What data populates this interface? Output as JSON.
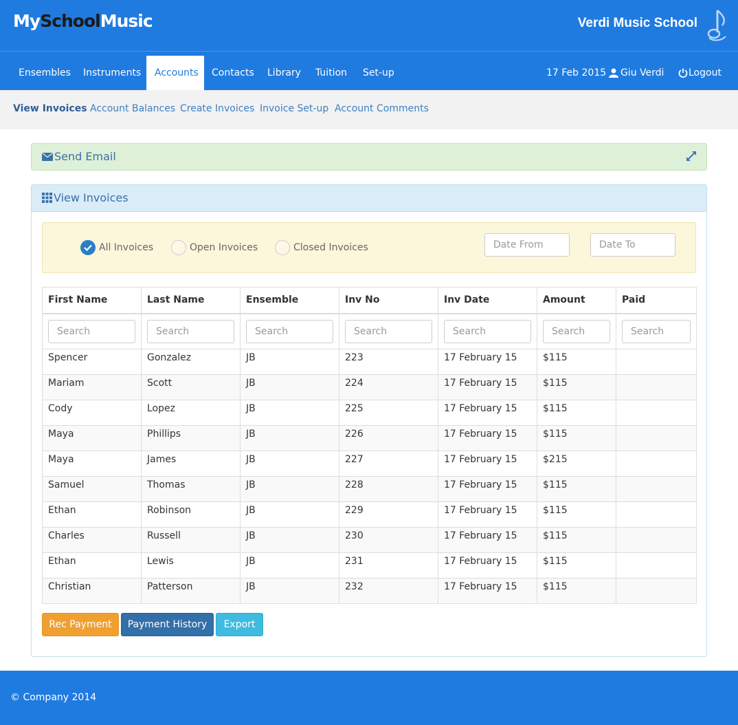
{
  "brand": {
    "logo_prefix": "My",
    "logo_mid": "School",
    "logo_suffix": "Music",
    "school_name": "Verdi Music School"
  },
  "nav": {
    "items": [
      "Ensembles",
      "Instruments",
      "Accounts",
      "Contacts",
      "Library",
      "Tuition",
      "Set-up"
    ],
    "active": "Accounts",
    "date": "17 Feb 2015",
    "user": "Giu Verdi",
    "logout": "Logout"
  },
  "subnav": {
    "items": [
      "View Invoices",
      "Account Balances",
      "Create Invoices",
      "Invoice Set-up",
      "Account Comments"
    ],
    "active": "View Invoices"
  },
  "email_panel": {
    "title": "Send Email"
  },
  "invoices_panel": {
    "title": "View Invoices",
    "filters": {
      "all": "All Invoices",
      "open": "Open Invoices",
      "closed": "Closed Invoices",
      "selected": "All Invoices"
    },
    "date_from_placeholder": "Date From",
    "date_to_placeholder": "Date To",
    "columns": [
      "First Name",
      "Last Name",
      "Ensemble",
      "Inv No",
      "Inv Date",
      "Amount",
      "Paid"
    ],
    "search_placeholder": "Search",
    "rows": [
      [
        "Spencer",
        "Gonzalez",
        "JB",
        "223",
        "17 February 15",
        "$115",
        ""
      ],
      [
        "Mariam",
        "Scott",
        "JB",
        "224",
        "17 February 15",
        "$115",
        ""
      ],
      [
        "Cody",
        "Lopez",
        "JB",
        "225",
        "17 February 15",
        "$115",
        ""
      ],
      [
        "Maya",
        "Phillips",
        "JB",
        "226",
        "17 February 15",
        "$115",
        ""
      ],
      [
        "Maya",
        "James",
        "JB",
        "227",
        "17 February 15",
        "$215",
        ""
      ],
      [
        "Samuel",
        "Thomas",
        "JB",
        "228",
        "17 February 15",
        "$115",
        ""
      ],
      [
        "Ethan",
        "Robinson",
        "JB",
        "229",
        "17 February 15",
        "$115",
        ""
      ],
      [
        "Charles",
        "Russell",
        "JB",
        "230",
        "17 February 15",
        "$115",
        ""
      ],
      [
        "Ethan",
        "Lewis",
        "JB",
        "231",
        "17 February 15",
        "$115",
        ""
      ],
      [
        "Christian",
        "Patterson",
        "JB",
        "232",
        "17 February 15",
        "$115",
        ""
      ]
    ],
    "buttons": {
      "rec_payment": "Rec Payment",
      "payment_history": "Payment History",
      "export": "Export"
    }
  },
  "footer": {
    "text": "© Company 2014"
  },
  "colors": {
    "brand_blue": "#1f7be0",
    "success_bg": "#dff0d8",
    "info_bg": "#d9ecf7",
    "warning_bg": "#fcf6da"
  },
  "icons": {
    "email": "envelope-icon",
    "grid": "th-icon",
    "expand": "expand-icon",
    "user": "user-icon",
    "power": "power-icon",
    "note": "music-note-icon"
  }
}
